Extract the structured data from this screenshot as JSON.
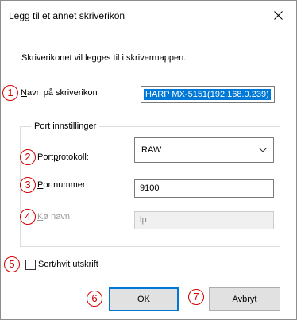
{
  "dialog": {
    "title": "Legg til et annet skriverikon",
    "description": "Skriverikonet vil legges til i skrivermappen.",
    "icon_name": {
      "label_pre": "N",
      "label_post": "avn på skriverikon",
      "value": "HARP MX-5151(192.168.0.239)"
    },
    "port_group": {
      "title": "Port innstillinger",
      "protocol": {
        "label_pre": "Port",
        "label_under": "p",
        "label_post": "rotokoll:",
        "value": "RAW"
      },
      "port_number": {
        "label_pre": "",
        "label_under": "P",
        "label_post": "ortnummer:",
        "value": "9100"
      },
      "queue_name": {
        "label_pre": "",
        "label_under": "K",
        "label_post": "ø navn:",
        "value": "lp"
      }
    },
    "monochrome": {
      "label_under": "S",
      "label_post": "ort/hvit utskrift",
      "checked": false
    },
    "buttons": {
      "ok": "OK",
      "cancel": "Avbryt"
    },
    "markers": [
      "1",
      "2",
      "3",
      "4",
      "5",
      "6",
      "7"
    ],
    "colors": {
      "marker_red": "#d40000",
      "selection_blue": "#0078d7"
    },
    "icons": {
      "close": "close-icon",
      "dropdown": "chevron-down-icon"
    }
  }
}
